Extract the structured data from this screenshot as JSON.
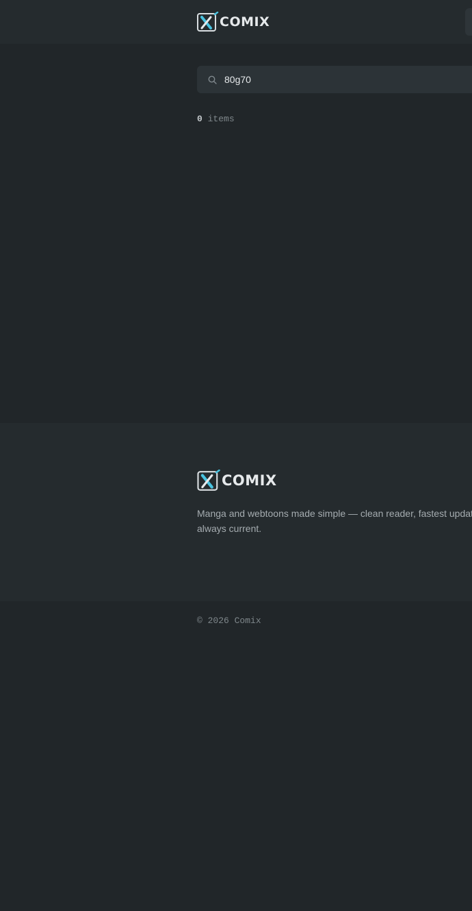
{
  "header": {
    "brand": "COMIX"
  },
  "search": {
    "value": "80g70",
    "icon": "search-icon"
  },
  "results": {
    "count": "0",
    "unit": "items"
  },
  "footer": {
    "brand": "COMIX",
    "tagline": "Manga and webtoons made simple — clean reader, fastest updates, always current.",
    "copyright": "© 2026 Comix"
  },
  "colors": {
    "background": "#212629",
    "surface": "#252b2e",
    "accent": "#49c3e0",
    "text": "#e6e9eb"
  }
}
